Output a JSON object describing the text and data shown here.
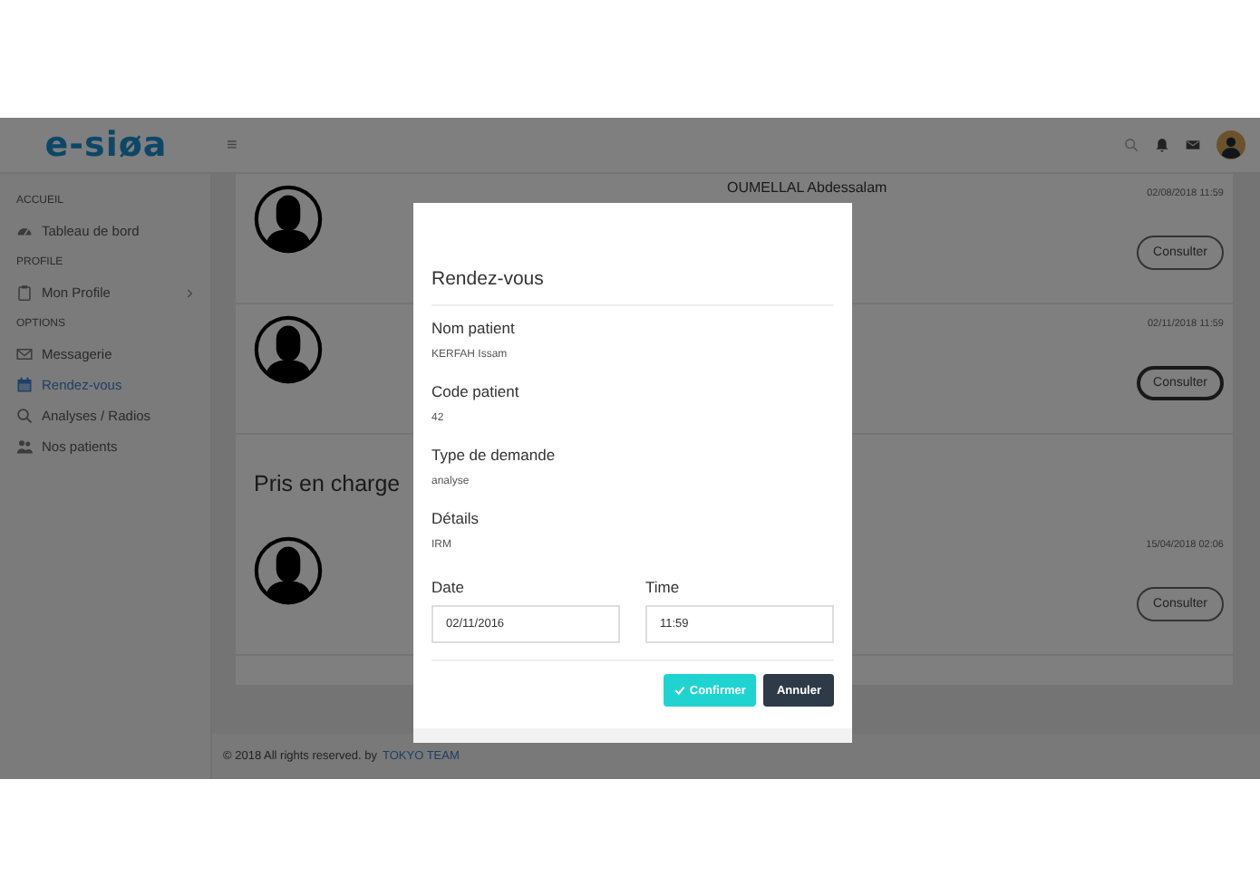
{
  "brand": {
    "logo": "e-siøa"
  },
  "header": {
    "menu_icon": "≡"
  },
  "sidebar": {
    "sections": [
      {
        "title": "ACCUEIL",
        "items": [
          {
            "label": "Tableau de bord",
            "selected": false,
            "has_submenu": false
          }
        ]
      },
      {
        "title": "PROFILE",
        "items": [
          {
            "label": "Mon Profile",
            "selected": false,
            "has_submenu": true
          }
        ]
      },
      {
        "title": "OPTIONS",
        "items": [
          {
            "label": "Messagerie",
            "selected": false,
            "has_submenu": false
          },
          {
            "label": "Rendez-vous",
            "selected": true,
            "has_submenu": false
          },
          {
            "label": "Analyses / Radios",
            "selected": false,
            "has_submenu": false
          },
          {
            "label": "Nos patients",
            "selected": false,
            "has_submenu": false
          }
        ]
      }
    ]
  },
  "requests": [
    {
      "name": "OUMELLAL Abdessalam",
      "date": "02/08/2018 11:59",
      "button": "Consulter",
      "focused": false
    },
    {
      "date": "02/11/2018 11:59",
      "button": "Consulter",
      "focused": true
    }
  ],
  "taken_in_charge": {
    "title": "Pris en charge",
    "rows": [
      {
        "date": "15/04/2018 02:06",
        "button": "Consulter",
        "focused": false
      }
    ]
  },
  "footer": {
    "text": "© 2018 All rights reserved. by",
    "link": "TOKYO TEAM"
  },
  "modal": {
    "title": "Rendez-vous",
    "fields": [
      {
        "label": "Nom patient",
        "value": "KERFAH Issam"
      },
      {
        "label": "Code patient",
        "value": "42"
      },
      {
        "label": "Type de demande",
        "value": "analyse"
      },
      {
        "label": "Détails",
        "value": "IRM"
      }
    ],
    "date": {
      "label": "Date",
      "value": "02/11/2016"
    },
    "time": {
      "label": "Time",
      "value": "11:59"
    },
    "confirm": "Confirmer",
    "cancel": "Annuler"
  }
}
